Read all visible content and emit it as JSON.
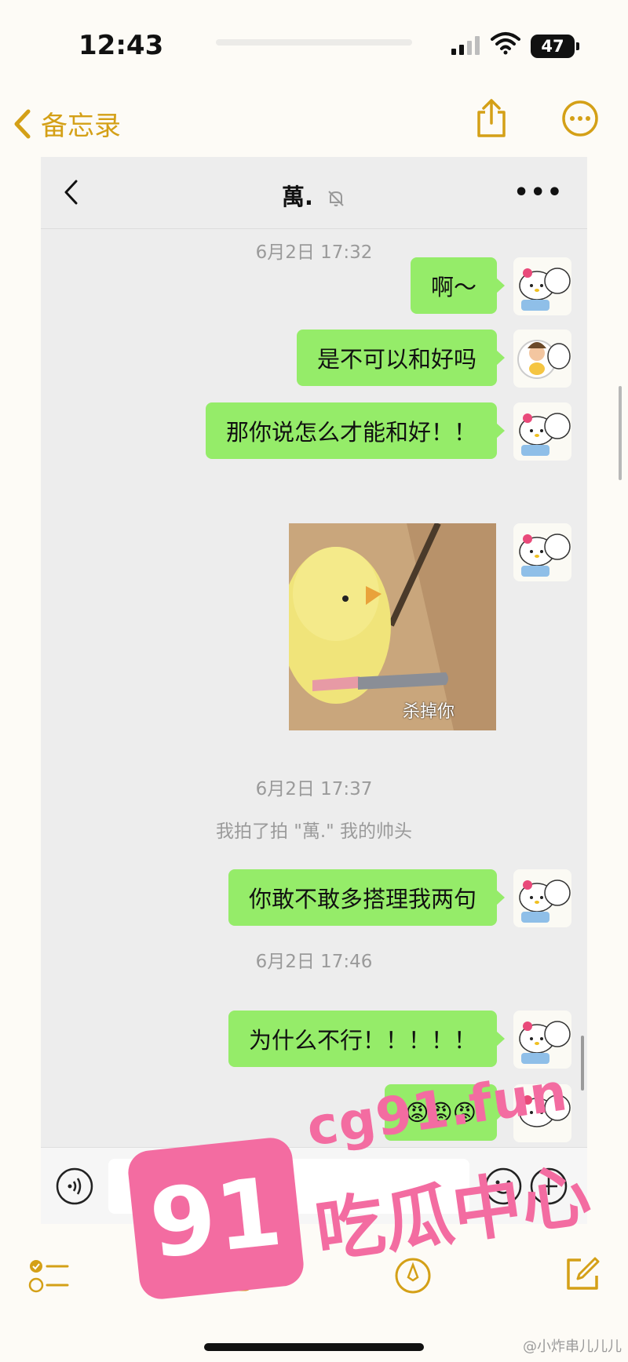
{
  "status_bar": {
    "time": "12:43",
    "battery": "47"
  },
  "notes_header": {
    "back_label": "备忘录"
  },
  "chat": {
    "contact_name": "萬.",
    "more": "•••",
    "timestamps": [
      "6月2日 17:32",
      "6月2日 17:37",
      "6月2日 17:46"
    ],
    "messages": [
      {
        "text": "啊～"
      },
      {
        "text": "是不可以和好吗"
      },
      {
        "text": "那你说怎么才能和好！！"
      },
      {
        "text": "你敢不敢多搭理我两句"
      },
      {
        "text": "为什么不行！！！！！"
      },
      {
        "text": "😡😡😡"
      }
    ],
    "sticker_caption": "杀掉你",
    "system_message": "我拍了拍 \"萬.\" 我的帅头"
  },
  "watermark": {
    "number": "91",
    "url": "cg91.fun",
    "tagline": "吃瓜中心"
  },
  "credit": "@小炸串儿儿儿",
  "colors": {
    "accent": "#d4a017",
    "bubble": "#95ec69",
    "watermark": "#f36ca1"
  }
}
